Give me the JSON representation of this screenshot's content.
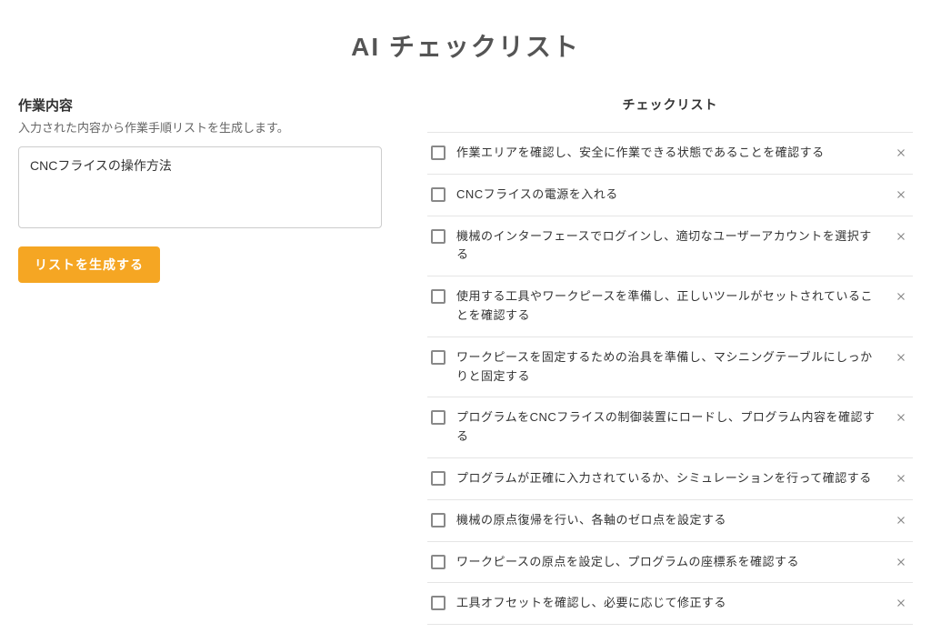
{
  "title": "AI チェックリスト",
  "left": {
    "label": "作業内容",
    "description": "入力された内容から作業手順リストを生成します。",
    "textarea_value": "CNCフライスの操作方法",
    "button_label": "リストを生成する"
  },
  "right": {
    "header": "チェックリスト",
    "items": [
      {
        "text": "作業エリアを確認し、安全に作業できる状態であることを確認する"
      },
      {
        "text": "CNCフライスの電源を入れる"
      },
      {
        "text": "機械のインターフェースでログインし、適切なユーザーアカウントを選択する"
      },
      {
        "text": "使用する工具やワークピースを準備し、正しいツールがセットされていることを確認する"
      },
      {
        "text": "ワークピースを固定するための治具を準備し、マシニングテーブルにしっかりと固定する"
      },
      {
        "text": "プログラムをCNCフライスの制御装置にロードし、プログラム内容を確認する"
      },
      {
        "text": "プログラムが正確に入力されているか、シミュレーションを行って確認する"
      },
      {
        "text": "機械の原点復帰を行い、各軸のゼロ点を設定する"
      },
      {
        "text": "ワークピースの原点を設定し、プログラムの座標系を確認する"
      },
      {
        "text": "工具オフセットを確認し、必要に応じて修正する"
      }
    ]
  }
}
